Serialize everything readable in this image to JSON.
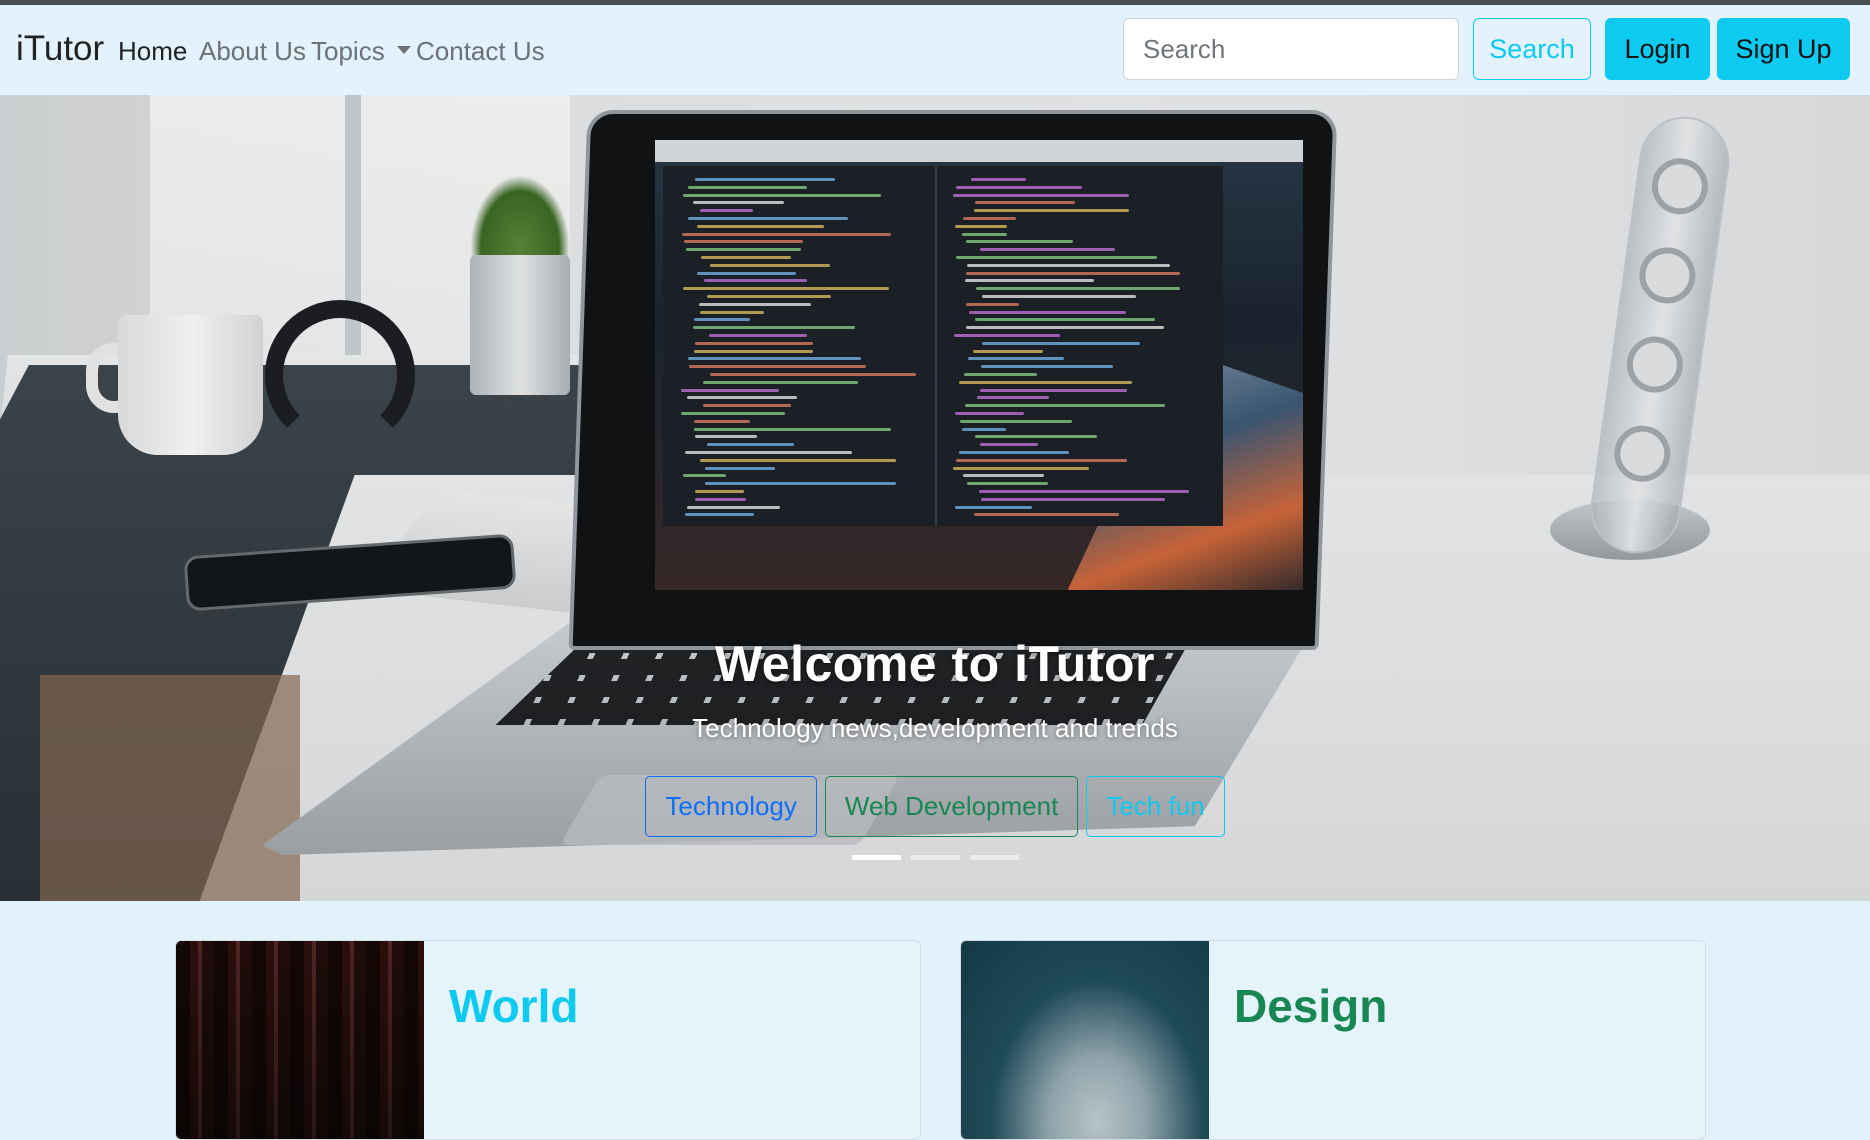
{
  "navbar": {
    "brand": "iTutor",
    "links": [
      {
        "label": "Home",
        "active": true
      },
      {
        "label": "About Us",
        "active": false
      },
      {
        "label": "Topics",
        "active": false,
        "dropdown": true
      },
      {
        "label": "Contact Us",
        "active": false
      }
    ],
    "search": {
      "placeholder": "Search",
      "value": ""
    },
    "search_button": "Search",
    "login_button": "Login",
    "signup_button": "Sign Up"
  },
  "hero": {
    "title": "Welcome to iTutor",
    "subtitle": "Technology news,development and trends",
    "buttons": [
      {
        "label": "Technology",
        "style": "primary"
      },
      {
        "label": "Web Development",
        "style": "success"
      },
      {
        "label": "Tech fun",
        "style": "info"
      }
    ],
    "slides_count": 3,
    "active_slide": 1
  },
  "cards": [
    {
      "title": "World",
      "color": "#0dcaf0"
    },
    {
      "title": "Design",
      "color": "#198754"
    }
  ],
  "colors": {
    "navbar_bg": "#e3f2fd",
    "page_bg": "#e1f2fc",
    "info": "#0dcaf0",
    "primary": "#0d6efd",
    "success": "#198754"
  }
}
